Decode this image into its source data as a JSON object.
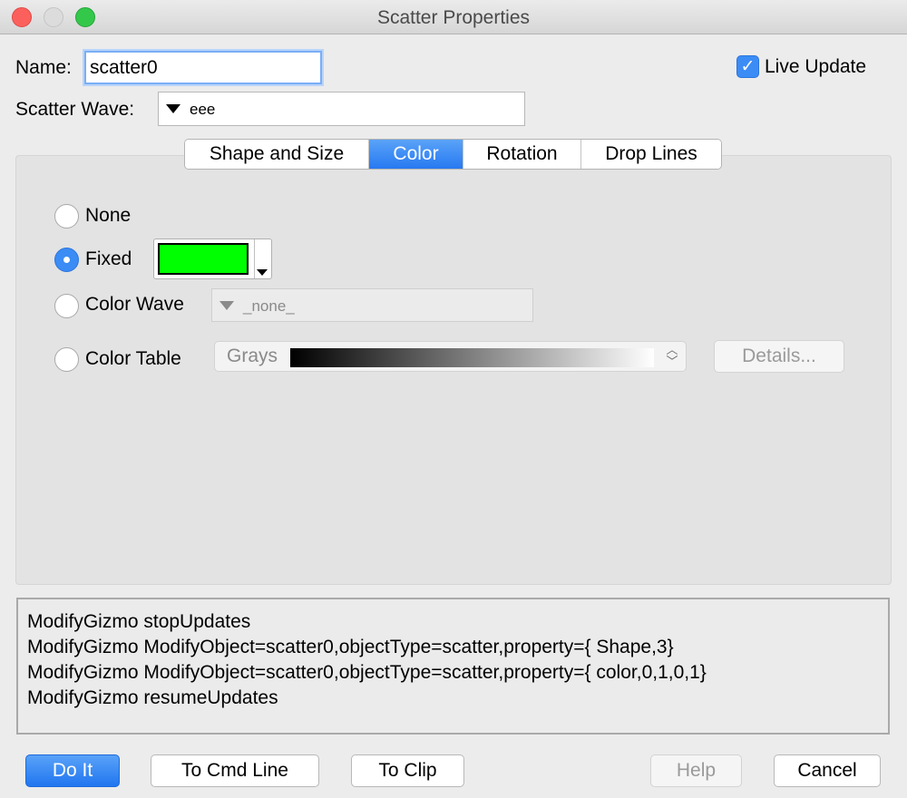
{
  "window": {
    "title": "Scatter Properties"
  },
  "name_field": {
    "label": "Name:",
    "value": "scatter0"
  },
  "live_update": {
    "label": "Live Update",
    "checked": true
  },
  "scatter_wave": {
    "label": "Scatter Wave:",
    "value": "eee"
  },
  "tabs": [
    {
      "label": "Shape and Size",
      "active": false
    },
    {
      "label": "Color",
      "active": true
    },
    {
      "label": "Rotation",
      "active": false
    },
    {
      "label": "Drop Lines",
      "active": false
    }
  ],
  "color_options": {
    "none_label": "None",
    "fixed_label": "Fixed",
    "fixed_color": "#00ff00",
    "color_wave_label": "Color Wave",
    "color_wave_value": "_none_",
    "color_table_label": "Color Table",
    "color_table_value": "Grays",
    "details_button": "Details...",
    "selected": "Fixed"
  },
  "command_lines": [
    "ModifyGizmo stopUpdates",
    "ModifyGizmo ModifyObject=scatter0,objectType=scatter,property={ Shape,3}",
    "ModifyGizmo ModifyObject=scatter0,objectType=scatter,property={ color,0,1,0,1}",
    "ModifyGizmo resumeUpdates"
  ],
  "buttons": {
    "do_it": "Do It",
    "to_cmd_line": "To Cmd Line",
    "to_clip": "To Clip",
    "help": "Help",
    "cancel": "Cancel"
  },
  "colors": {
    "accent": "#3b8cf5",
    "fixed_swatch": "#00ff00"
  }
}
